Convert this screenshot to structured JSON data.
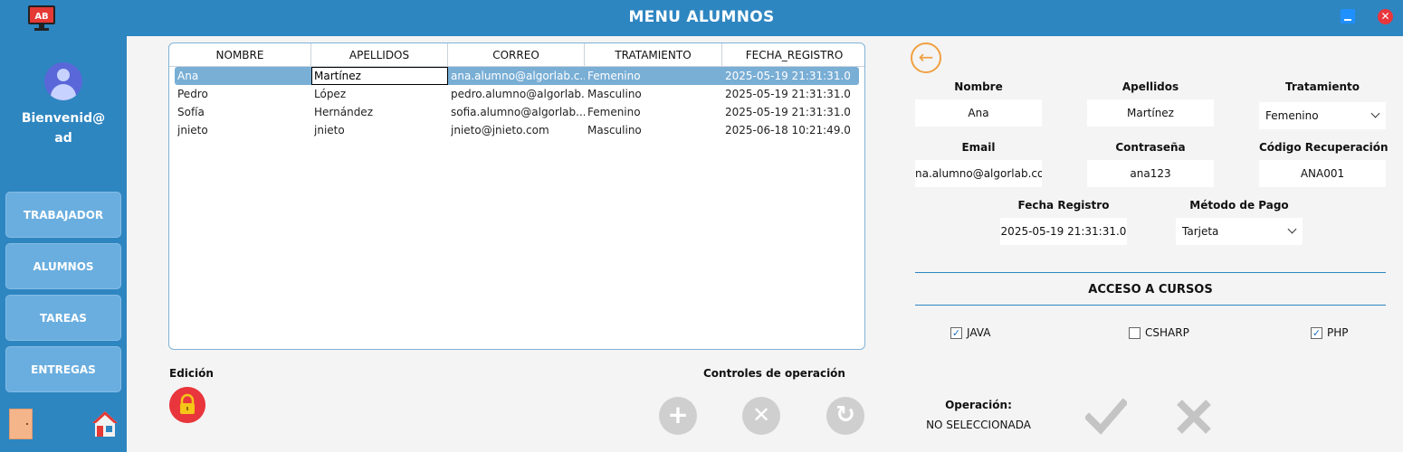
{
  "window": {
    "title": "MENU ALUMNOS",
    "minimize_icon": "minimize-icon",
    "close_icon": "close-icon",
    "accent_color": "#2e86c1"
  },
  "sidebar": {
    "welcome_line1": "Bienvenid@",
    "welcome_line2": "ad",
    "items": [
      {
        "label": "TRABAJADOR"
      },
      {
        "label": "ALUMNOS"
      },
      {
        "label": "TAREAS"
      },
      {
        "label": "ENTREGAS"
      }
    ],
    "footer_icons": [
      "door-icon",
      "home-icon"
    ]
  },
  "grid": {
    "columns": [
      "NOMBRE",
      "APELLIDOS",
      "CORREO",
      "TRATAMIENTO",
      "FECHA_REGISTRO"
    ],
    "rows": [
      [
        "Ana",
        "Martínez",
        "ana.alumno@algorlab.c...",
        "Femenino",
        "2025-05-19 21:31:31.0"
      ],
      [
        "Pedro",
        "López",
        "pedro.alumno@algorlab....",
        "Masculino",
        "2025-05-19 21:31:31.0"
      ],
      [
        "Sofía",
        "Hernández",
        "sofia.alumno@algorlab....",
        "Femenino",
        "2025-05-19 21:31:31.0"
      ],
      [
        "jnieto",
        "jnieto",
        "jnieto@jnieto.com",
        "Masculino",
        "2025-06-18 10:21:49.0"
      ]
    ],
    "selected_row": 0
  },
  "form": {
    "nombre_label": "Nombre",
    "nombre_value": "Ana",
    "apellidos_label": "Apellidos",
    "apellidos_value": "Martínez",
    "tratamiento_label": "Tratamiento",
    "tratamiento_value": "Femenino",
    "email_label": "Email",
    "email_value": "na.alumno@algorlab.com",
    "password_label": "Contraseña",
    "password_value": "ana123",
    "recovery_label": "Código Recuperación",
    "recovery_value": "ANA001",
    "fecha_label": "Fecha Registro",
    "fecha_value": "2025-05-19 21:31:31.0",
    "pago_label": "Método de Pago",
    "pago_value": "Tarjeta"
  },
  "courses": {
    "title": "ACCESO A CURSOS",
    "items": [
      {
        "label": "JAVA",
        "checked": true
      },
      {
        "label": "CSHARP",
        "checked": false
      },
      {
        "label": "PHP",
        "checked": true
      }
    ]
  },
  "edition": {
    "label": "Edición",
    "lock_icon": "lock-icon"
  },
  "controls": {
    "label": "Controles de operación",
    "icons": [
      "add-icon",
      "delete-icon",
      "refresh-icon"
    ]
  },
  "operation": {
    "label": "Operación:",
    "value": "NO SELECCIONADA",
    "confirm_icon": "check-icon",
    "cancel_icon": "cancel-icon"
  }
}
